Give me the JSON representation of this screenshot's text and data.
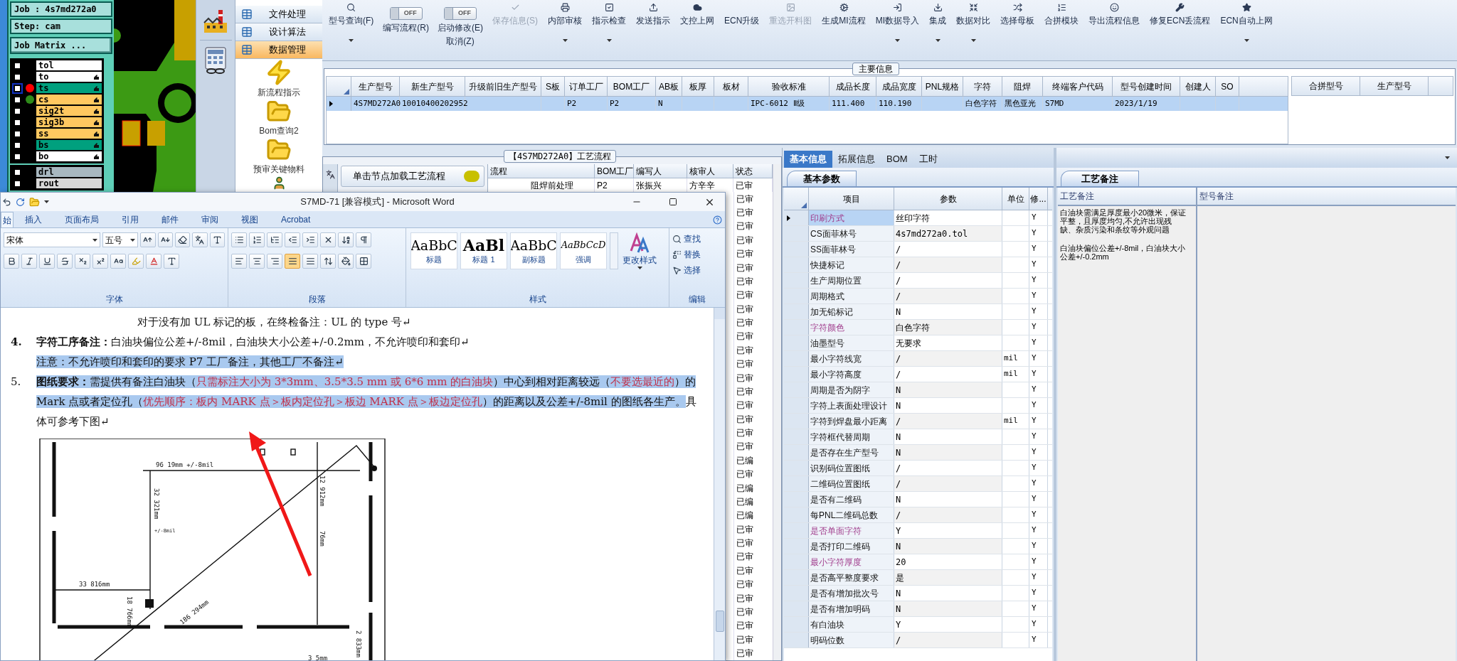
{
  "cam_panel": {
    "job": "Job : 4s7md272a0",
    "step": "Step: cam",
    "matrix_button": "Job Matrix ...",
    "layers": [
      {
        "name": "tol",
        "color": "#ffffff",
        "checked": false,
        "active": false,
        "displayed": false,
        "pointer": false
      },
      {
        "name": "to",
        "color": "#ffffff",
        "checked": false,
        "active": false,
        "displayed": false,
        "pointer": true
      },
      {
        "name": "ts",
        "color": "#00a07e",
        "checked": false,
        "active": true,
        "displayed": true,
        "pointer": true
      },
      {
        "name": "cs",
        "color": "#ffc860",
        "checked": false,
        "active": false,
        "displayed": true,
        "pointer": true
      },
      {
        "name": "sig2t",
        "color": "#ffc860",
        "checked": false,
        "active": false,
        "displayed": false,
        "pointer": true
      },
      {
        "name": "sig3b",
        "color": "#ffc860",
        "checked": false,
        "active": false,
        "displayed": false,
        "pointer": true
      },
      {
        "name": "ss",
        "color": "#ffc860",
        "checked": false,
        "active": false,
        "displayed": false,
        "pointer": true
      },
      {
        "name": "bs",
        "color": "#00a07e",
        "checked": false,
        "active": false,
        "displayed": false,
        "pointer": true
      },
      {
        "name": "bo",
        "color": "#ffffff",
        "checked": false,
        "active": false,
        "displayed": false,
        "pointer": true
      }
    ],
    "drill_layers": [
      {
        "name": "drl",
        "color": "#a8b8c0",
        "checked": false
      },
      {
        "name": "rout",
        "color": "#d8d8d8",
        "checked": false
      }
    ]
  },
  "nav": {
    "sections": [
      {
        "label": "文件处理",
        "selected": false
      },
      {
        "label": "设计算法",
        "selected": false
      },
      {
        "label": "数据管理",
        "selected": true
      }
    ],
    "launchers": [
      {
        "kind": "bolt",
        "label": "新流程指示"
      },
      {
        "kind": "folder",
        "label": "Bom查询2"
      },
      {
        "kind": "folder",
        "label": "预审关键物料"
      },
      {
        "kind": "person"
      }
    ]
  },
  "toolbar": [
    {
      "kind": "button",
      "label": "型号查询(F)",
      "menu": true,
      "disabled": false
    },
    {
      "kind": "toggle",
      "state": "OFF",
      "on": false,
      "labels": [
        "编写流程(R)"
      ]
    },
    {
      "kind": "toggle",
      "state": "OFF",
      "on": false,
      "labels": [
        "启动修改(E)",
        "取消(Z)"
      ]
    },
    {
      "kind": "button",
      "label": "保存信息(S)",
      "menu": false,
      "disabled": true
    },
    {
      "kind": "button",
      "label": "内部审核",
      "menu": true,
      "disabled": false
    },
    {
      "kind": "button",
      "label": "指示检查",
      "menu": true,
      "disabled": false
    },
    {
      "kind": "button",
      "label": "发送指示",
      "menu": false,
      "disabled": false
    },
    {
      "kind": "button",
      "label": "文控上网",
      "menu": false,
      "disabled": false
    },
    {
      "kind": "button",
      "label": "ECN升级",
      "menu": false,
      "disabled": false
    },
    {
      "kind": "button",
      "label": "重选开料图",
      "menu": false,
      "disabled": true
    },
    {
      "kind": "button",
      "label": "生成MI流程",
      "menu": false,
      "disabled": false
    },
    {
      "kind": "button",
      "label": "MI数据导入",
      "menu": true,
      "disabled": false
    },
    {
      "kind": "button",
      "label": "集成",
      "menu": true,
      "disabled": false
    },
    {
      "kind": "button",
      "label": "数据对比",
      "menu": true,
      "disabled": false
    },
    {
      "kind": "button",
      "label": "选择母板",
      "menu": false,
      "disabled": false
    },
    {
      "kind": "button",
      "label": "合拼模块",
      "menu": false,
      "disabled": false
    },
    {
      "kind": "button",
      "label": "导出流程信息",
      "menu": false,
      "disabled": false
    },
    {
      "kind": "button",
      "label": "修复ECN丢流程",
      "menu": false,
      "disabled": false
    },
    {
      "kind": "button",
      "label": "ECN自动上网",
      "menu": true,
      "disabled": false
    }
  ],
  "main_info": {
    "title": "主要信息",
    "columns": [
      "生产型号",
      "新生产型号",
      "升级前旧生产型号",
      "S板",
      "订单工厂",
      "BOM工厂",
      "AB板",
      "板厚",
      "板材",
      "验收标准",
      "成品长度",
      "成品宽度",
      "PNL规格",
      "字符",
      "阻焊",
      "终端客户代码",
      "型号创建时间",
      "创建人",
      "SO"
    ],
    "rows": [
      {
        "selected": true,
        "cells": [
          "4S7MD272A0",
          "10010400202952",
          null,
          null,
          "P2",
          "P2",
          "N",
          null,
          null,
          "IPC-6012 Ⅱ级",
          "111.400",
          "110.190",
          null,
          "白色字符",
          "黑色亚光",
          "S7MD",
          "2023/1/19",
          null,
          null
        ]
      }
    ],
    "side_columns": [
      "合拼型号",
      "生产型号"
    ]
  },
  "process": {
    "title": "【4S7MD272A0】工艺流程",
    "load_button": "单击节点加载工艺流程",
    "columns": [
      "流程",
      "BOM工厂",
      "编写人",
      "核审人",
      "状态"
    ],
    "first_row": [
      "阻焊前处理",
      "P2",
      "张振兴",
      "方辛辛",
      "已审"
    ],
    "statuses": [
      "已审",
      "已审",
      "已审",
      "已审",
      "已审",
      "已审",
      "已审",
      "已审",
      "已审",
      "已审",
      "已审",
      "已审",
      "已审",
      "已审",
      "已审",
      "已审",
      "已审",
      "已审",
      "已审",
      "已编",
      "已审",
      "已编",
      "已编",
      "已编",
      "已审",
      "已审",
      "已审",
      "已审",
      "已审",
      "已审",
      "已审",
      "已审",
      "已审",
      "已审"
    ]
  },
  "details": {
    "tabs": [
      {
        "label": "基本信息",
        "selected": true
      },
      {
        "label": "拓展信息",
        "selected": false
      },
      {
        "label": "BOM",
        "selected": false
      },
      {
        "label": "工时",
        "selected": false
      }
    ],
    "subtab": "基本参数",
    "columns": [
      "项目",
      "参数",
      "单位",
      "修..."
    ],
    "rows": [
      {
        "item": "印刷方式",
        "value": "丝印字符",
        "flag": "Y",
        "highlight": true,
        "selected": true
      },
      {
        "item": "CS面菲林号",
        "value": "4s7md272a0.tol",
        "flag": "Y",
        "highlight": false,
        "selected": false
      },
      {
        "item": "SS面菲林号",
        "value": "/",
        "flag": "Y",
        "highlight": false,
        "selected": false
      },
      {
        "item": "快捷标记",
        "value": "/",
        "flag": "Y",
        "highlight": false,
        "selected": false
      },
      {
        "item": "生产周期位置",
        "value": "/",
        "flag": "Y",
        "highlight": false,
        "selected": false
      },
      {
        "item": "周期格式",
        "value": "/",
        "flag": "Y",
        "highlight": false,
        "selected": false
      },
      {
        "item": "加无铅标记",
        "value": "N",
        "flag": "Y",
        "highlight": false,
        "selected": false
      },
      {
        "item": "字符颜色",
        "value": "白色字符",
        "flag": "Y",
        "highlight": true,
        "selected": false
      },
      {
        "item": "油墨型号",
        "value": "无要求",
        "flag": "Y",
        "highlight": false,
        "selected": false
      },
      {
        "item": "最小字符线宽",
        "value": "/",
        "unit": "mil",
        "flag": "Y",
        "highlight": false,
        "selected": false
      },
      {
        "item": "最小字符高度",
        "value": "/",
        "unit": "mil",
        "flag": "Y",
        "highlight": false,
        "selected": false
      },
      {
        "item": "周期是否为阴字",
        "value": "N",
        "flag": "Y",
        "highlight": false,
        "selected": false
      },
      {
        "item": "字符上表面处理设计",
        "value": "N",
        "flag": "Y",
        "highlight": false,
        "selected": false
      },
      {
        "item": "字符到焊盘最小距离",
        "value": "/",
        "unit": "mil",
        "flag": "Y",
        "highlight": false,
        "selected": false
      },
      {
        "item": "字符框代替周期",
        "value": "N",
        "flag": "Y",
        "highlight": false,
        "selected": false
      },
      {
        "item": "是否存在生产型号",
        "value": "N",
        "flag": "Y",
        "highlight": false,
        "selected": false
      },
      {
        "item": "识别码位置图纸",
        "value": "/",
        "flag": "Y",
        "highlight": false,
        "selected": false
      },
      {
        "item": "二维码位置图纸",
        "value": "/",
        "flag": "Y",
        "highlight": false,
        "selected": false
      },
      {
        "item": "是否有二维码",
        "value": "N",
        "flag": "Y",
        "highlight": false,
        "selected": false
      },
      {
        "item": "每PNL二维码总数",
        "value": "/",
        "flag": "Y",
        "highlight": false,
        "selected": false
      },
      {
        "item": "是否单面字符",
        "value": "Y",
        "flag": "Y",
        "highlight": true,
        "selected": false
      },
      {
        "item": "是否打印二维码",
        "value": "N",
        "flag": "Y",
        "highlight": false,
        "selected": false
      },
      {
        "item": "最小字符厚度",
        "value": "20",
        "flag": "Y",
        "highlight": true,
        "selected": false
      },
      {
        "item": "是否高平整度要求",
        "value": "是",
        "flag": "Y",
        "highlight": false,
        "selected": false
      },
      {
        "item": "是否有增加批次号",
        "value": "N",
        "flag": "Y",
        "highlight": false,
        "selected": false
      },
      {
        "item": "是否有增加明码",
        "value": "N",
        "flag": "Y",
        "highlight": false,
        "selected": false
      },
      {
        "item": "有白油块",
        "value": "Y",
        "flag": "Y",
        "highlight": false,
        "selected": false
      },
      {
        "item": "明码位数",
        "value": "/",
        "flag": "Y",
        "highlight": false,
        "selected": false
      }
    ]
  },
  "remarks": {
    "tab": "工艺备注",
    "columns": [
      "工艺备注",
      "型号备注"
    ],
    "notes": [
      "白油块需满足厚度最小20微米，保证平整，且厚度均匀,不允许出现残缺、杂质污染和条纹等外观问题",
      "白油块偏位公差+/-8mil，白油块大小公差+/-0.2mm"
    ]
  },
  "word": {
    "title": "S7MD-71 [兼容模式] - Microsoft Word",
    "tabs": [
      {
        "label": "始",
        "selected": true
      },
      {
        "label": "插入",
        "selected": false
      },
      {
        "label": "页面布局",
        "selected": false
      },
      {
        "label": "引用",
        "selected": false
      },
      {
        "label": "邮件",
        "selected": false
      },
      {
        "label": "审阅",
        "selected": false
      },
      {
        "label": "视图",
        "selected": false
      },
      {
        "label": "Acrobat",
        "selected": false
      }
    ],
    "font": "宋体",
    "size": "五号",
    "groups": [
      "字体",
      "段落",
      "样式",
      "编辑"
    ],
    "styles": [
      {
        "kind": "title",
        "preview": "AaBbC",
        "label": "标题"
      },
      {
        "kind": "heading",
        "preview": "AaBl",
        "label": "标题 1"
      },
      {
        "kind": "subtitle",
        "preview": "AaBbC",
        "label": "副标题"
      },
      {
        "kind": "emphasis",
        "preview": "AaBbCcD",
        "label": "强调"
      }
    ],
    "change_styles": "更改样式",
    "editing": [
      {
        "kind": "find",
        "label": "查找"
      },
      {
        "kind": "replace",
        "label": "替换"
      },
      {
        "kind": "select",
        "label": "选择"
      }
    ],
    "paragraphs": [
      {
        "segments": [
          {
            "text": "对于没有加 UL 标记的板，在终检备注：UL 的 type 号↵",
            "kind": "plain",
            "selected": false
          }
        ]
      },
      {
        "number": "4.",
        "segments": [
          {
            "text": "字符工序备注：",
            "kind": "bold",
            "selected": false
          },
          {
            "text": "白油块偏位公差+/-8mil，白油块大小公差+/-0.2mm，不允许喷印和套印↵",
            "kind": "plain",
            "selected": false
          }
        ]
      },
      {
        "segments": [
          {
            "text": "注意：不允许喷印和套印的要求 P7 工厂备注，其他工厂不备注↵",
            "kind": "plain",
            "selected": true
          }
        ]
      },
      {
        "number": "5.",
        "segments": [
          {
            "text": "图纸要求：",
            "kind": "bold",
            "selected": true
          },
          {
            "text": "需提供有备注白油块（",
            "kind": "plain",
            "selected": true
          },
          {
            "text": "只需标注大小为 3*3mm、3.5*3.5 mm 或 6*6 mm 的白油块",
            "kind": "red",
            "selected": true
          },
          {
            "text": "）中心到相对距离较远（",
            "kind": "plain",
            "selected": true
          },
          {
            "text": "不要选最近的",
            "kind": "red",
            "selected": true
          },
          {
            "text": "）的 Mark 点或者定位孔（",
            "kind": "plain",
            "selected": true
          },
          {
            "text": "优先顺序：板内 MARK 点＞板内定位孔＞板边 MARK 点＞板边定位孔",
            "kind": "red",
            "selected": true
          },
          {
            "text": "）的距离以及公差+/-8mil 的图纸各生产。",
            "kind": "plain",
            "selected": true
          },
          {
            "text": "具体可参考下图↵",
            "kind": "plain",
            "selected": false
          }
        ]
      }
    ],
    "figure_labels": [
      "96 19mm +/-8mil",
      "32 321mm",
      "+/-8mil",
      "12 912mm",
      "76mm",
      "33 816mm",
      "18 766mm",
      "186 294mm",
      "3 5mm",
      "2 833mm"
    ]
  }
}
